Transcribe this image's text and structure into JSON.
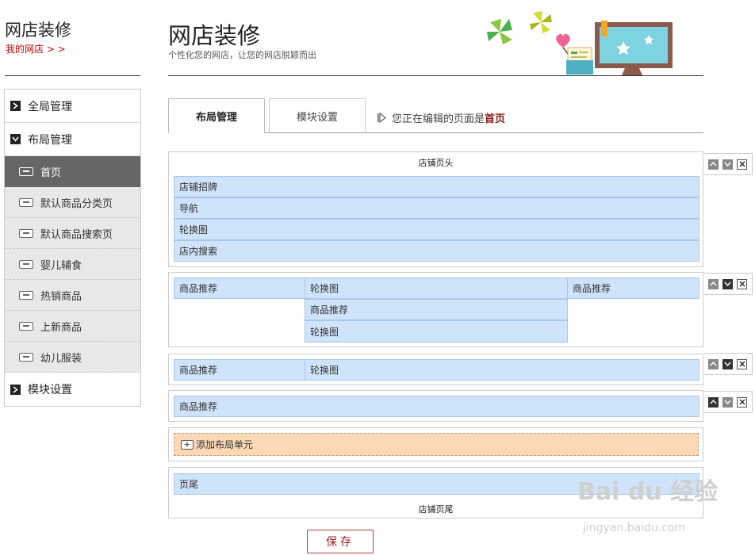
{
  "sidebar": {
    "title": "网店装修",
    "link": "我的网店 > >",
    "menu": {
      "global": "全局管理",
      "layout": "布局管理",
      "module": "模块设置",
      "pages": [
        "首页",
        "默认商品分类页",
        "默认商品搜索页",
        "婴儿辅食",
        "热销商品",
        "上新商品",
        "幼儿服装"
      ]
    }
  },
  "header": {
    "title": "网店装修",
    "subtitle": "个性化您的网店，让您的网店脱颖而出"
  },
  "tabs": {
    "layout": "布局管理",
    "module": "模块设置"
  },
  "editing": {
    "prefix": "您正在编辑的页面是",
    "page": "首页"
  },
  "units": {
    "header_caption": "店铺页头",
    "header_modules": [
      "店铺招牌",
      "导航",
      "轮换图",
      "店内搜索"
    ],
    "u2": {
      "left": "商品推荐",
      "middle": [
        "轮换图",
        "商品推荐",
        "轮换图"
      ],
      "right": "商品推荐"
    },
    "u3": {
      "left": "商品推荐",
      "right": "轮换图"
    },
    "u4": {
      "full": "商品推荐"
    },
    "add_label": "添加布局单元",
    "footer_module": "页尾",
    "footer_caption": "店铺页尾"
  },
  "save_label": "保存",
  "watermark": {
    "brand": "Bai du 经验",
    "url": "jingyan.baidu.com"
  },
  "colors": {
    "module_fill": "#cfe3fb",
    "add_fill": "#fcd8b6",
    "active_menu": "#666666",
    "accent_red": "#c00000"
  }
}
